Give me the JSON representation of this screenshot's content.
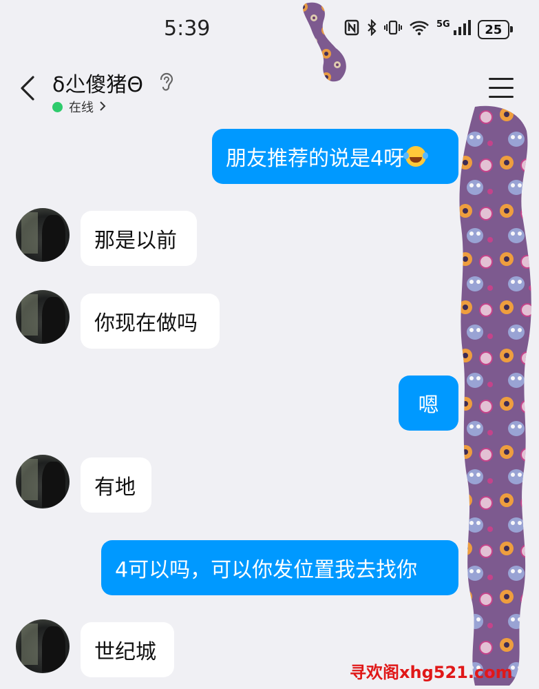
{
  "status_bar": {
    "time": "5:39",
    "network": "5G",
    "battery": "25"
  },
  "header": {
    "contact_name": "δ尐傻猪Θ",
    "online_status": "在线"
  },
  "messages": [
    {
      "side": "mine",
      "text": "朋友推荐的说是4呀"
    },
    {
      "side": "theirs",
      "text": "那是以前"
    },
    {
      "side": "theirs",
      "text": "你现在做吗"
    },
    {
      "side": "mine",
      "text": "嗯"
    },
    {
      "side": "theirs",
      "text": "有地"
    },
    {
      "side": "mine",
      "text": "4可以吗，可以你发位置我去找你"
    },
    {
      "side": "theirs",
      "text": "世纪城"
    }
  ],
  "watermark": "寻欢阁xhg521.com",
  "colors": {
    "my_bubble": "#0099ff",
    "their_bubble": "#ffffff",
    "online_dot": "#2ecb6c",
    "decoration": "#7d5a8f",
    "watermark": "#e01818"
  }
}
